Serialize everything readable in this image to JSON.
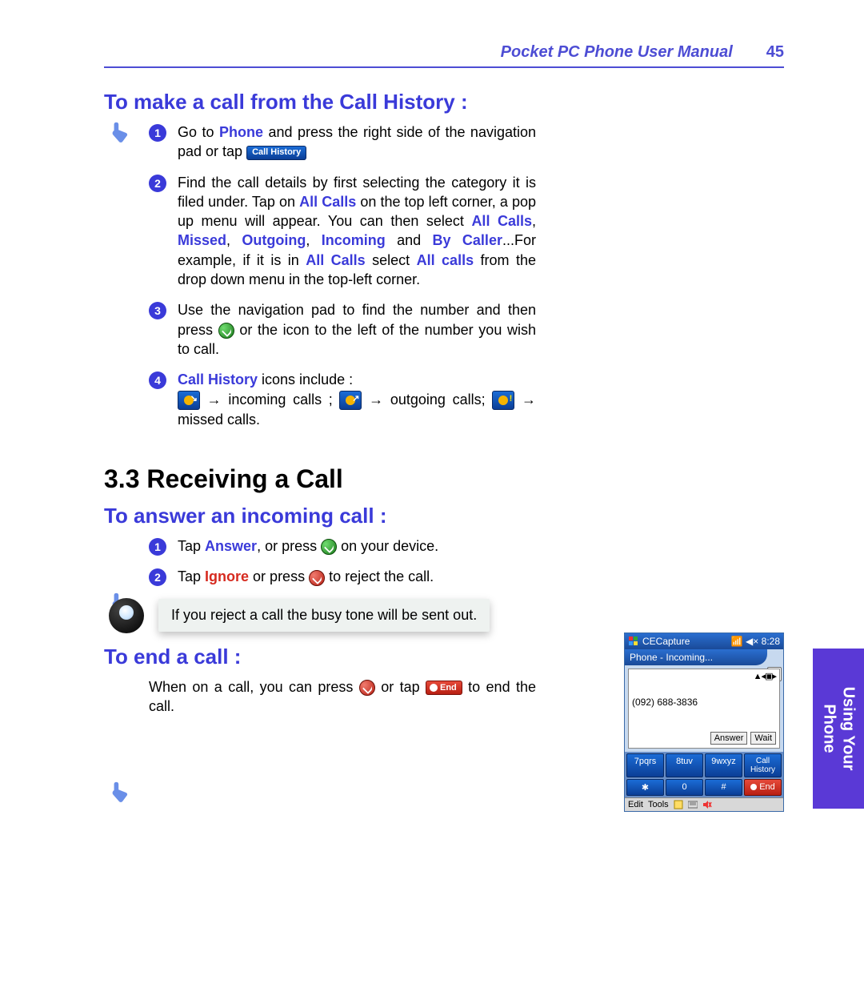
{
  "header": {
    "title": "Pocket PC Phone User Manual",
    "page": "45"
  },
  "sidebar": {
    "line1": "Using Your",
    "line2": "Phone"
  },
  "s1": {
    "heading": "To make a call from the Call History :",
    "steps": {
      "1": {
        "a": "Go to ",
        "phone": "Phone",
        "b": " and press the right side of the navigation pad or tap ",
        "chip": "Call History"
      },
      "2": {
        "a": "Find the call details by first selecting the category it is filed under. Tap on ",
        "allcalls1": "All Calls",
        "b": " on the top left corner, a pop up menu will appear. You can then select ",
        "allcalls2": "All Calls",
        "c1": ", ",
        "missed": "Missed",
        "c2": ", ",
        "outgoing": "Outgoing",
        "c3": ", ",
        "incoming": "Incoming",
        "c4": " and ",
        "bycaller": "By Caller",
        "d": "...For example, if it is in ",
        "allcalls3": "All Calls",
        "e": " select ",
        "allcalls4": "All calls",
        "f": " from the drop down menu in the top-left corner."
      },
      "3": {
        "a": "Use the navigation pad to find the number and then press ",
        "b": " or the icon to the left of the number you wish to call."
      },
      "4": {
        "lead": "Call History",
        "a": " icons include :",
        "in": " → incoming calls ; ",
        "out": " → outgoing calls; ",
        "miss": " → missed calls."
      }
    }
  },
  "s2": {
    "heading": "3.3  Receiving a Call"
  },
  "s3": {
    "heading": "To answer an incoming call :",
    "steps": {
      "1": {
        "a": "Tap ",
        "answer": "Answer",
        "b": ", or press ",
        "c": " on your device."
      },
      "2": {
        "a": "Tap ",
        "ignore": "Ignore",
        "b": " or press ",
        "c": " to reject the call."
      }
    },
    "tip": "If you reject a call the busy tone will be sent out."
  },
  "s4": {
    "heading": "To end a call :",
    "a": "When on a call, you can press ",
    "b": " or tap ",
    "endchip": "End",
    "c": " to end the call."
  },
  "phone": {
    "title": "CECapture",
    "clock": "8:28",
    "speaker": "◀×",
    "status": "Phone - Incoming...",
    "close": "×",
    "signal": "▲◂▣▸",
    "number": "(092) 688-3836",
    "answer": "Answer",
    "wait": "Wait",
    "keys": {
      "k7": "7pqrs",
      "k8": "8tuv",
      "k9": "9wxyz",
      "hist": "Call History",
      "ks": "✱",
      "k0": "0",
      "kp": "#",
      "end": "End"
    },
    "bottom": {
      "edit": "Edit",
      "tools": "Tools"
    }
  }
}
